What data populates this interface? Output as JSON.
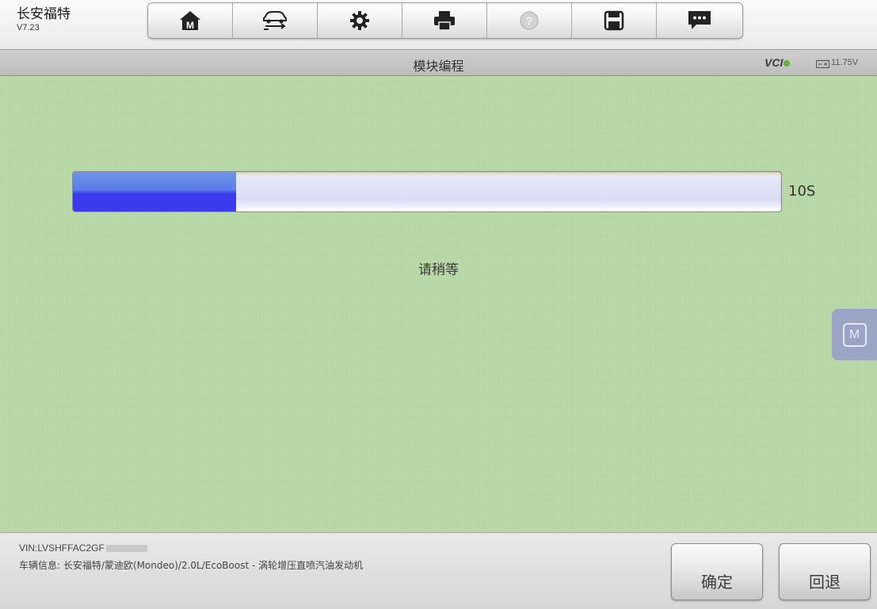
{
  "app": {
    "name": "长安福特",
    "version": "V7.23"
  },
  "toolbar": {
    "items": [
      {
        "name": "home",
        "icon": "home-icon"
      },
      {
        "name": "vehicle-swap",
        "icon": "car-swap-icon"
      },
      {
        "name": "settings",
        "icon": "gear-icon"
      },
      {
        "name": "print",
        "icon": "printer-icon"
      },
      {
        "name": "help",
        "icon": "help-icon",
        "enabled": false
      },
      {
        "name": "save",
        "icon": "save-icon"
      },
      {
        "name": "messages",
        "icon": "chat-icon"
      }
    ]
  },
  "header": {
    "title": "模块编程",
    "vci_label": "VCI",
    "vci_status_color": "#5fb52f",
    "voltage": "11.75V"
  },
  "main": {
    "progress": {
      "fraction": 0.23,
      "time_label": "10S",
      "fill_color": "#3b3bed"
    },
    "status_text": "请稍等",
    "float_button_label": "M"
  },
  "footer": {
    "vin": "VIN:LVSHFFAC2GF",
    "vehicle_info": "车辆信息: 长安福特/蒙迪欧(Mondeo)/2.0L/EcoBoost - 涡轮增压直喷汽油发动机",
    "buttons": {
      "confirm": "确定",
      "back": "回退"
    }
  },
  "colors": {
    "background": "#b4d6a3",
    "accent": "#3b3bed"
  }
}
